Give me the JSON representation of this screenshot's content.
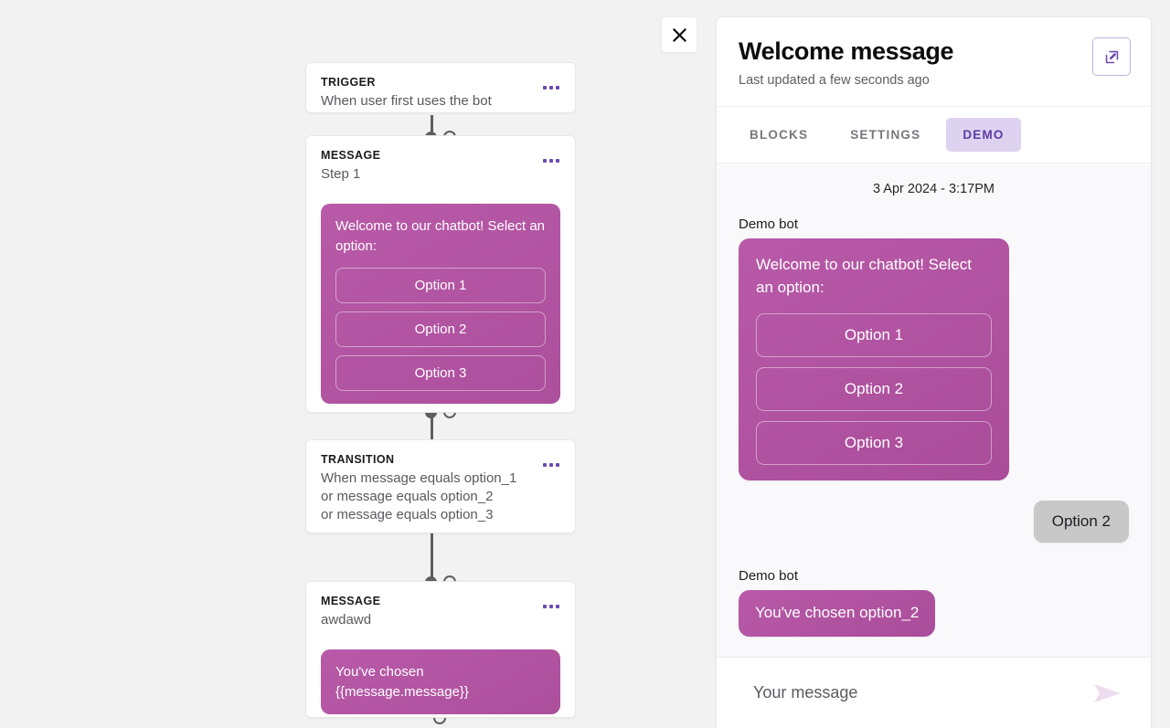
{
  "colors": {
    "canvas_bg": "#f2f2f2",
    "bubble_magenta": "#b2559f",
    "accent_purple": "#6c4ab0",
    "tab_active_bg": "#ddd2ef",
    "tab_active_text": "#5b3ba6",
    "user_bubble": "#c8c8c8",
    "chat_bg": "#f9f9fb",
    "connector": "#5e5e63",
    "send_icon": "#eddcee"
  },
  "flow": {
    "nodes": [
      {
        "kind": "TRIGGER",
        "title_lines": [
          "When user first uses the bot"
        ],
        "menu_icon": "ellipsis-icon",
        "bubble": null
      },
      {
        "kind": "MESSAGE",
        "title_lines": [
          "Step 1"
        ],
        "menu_icon": "ellipsis-icon",
        "bubble": {
          "text": "Welcome to our chatbot! Select an option:",
          "options": [
            "Option 1",
            "Option 2",
            "Option 3"
          ]
        }
      },
      {
        "kind": "TRANSITION",
        "title_lines": [
          "When message equals option_1",
          "or message equals option_2",
          "or message equals option_3"
        ],
        "menu_icon": "ellipsis-icon",
        "bubble": null
      },
      {
        "kind": "MESSAGE",
        "title_lines": [
          "awdawd"
        ],
        "menu_icon": "ellipsis-icon",
        "bubble": {
          "text": "You've chosen {{message.message}}",
          "options": []
        }
      }
    ]
  },
  "close_button": {
    "icon": "close-icon",
    "label": "Close"
  },
  "panel": {
    "title": "Welcome message",
    "subtitle": "Last updated a few seconds ago",
    "edit_button": {
      "icon": "edit-square-icon",
      "label": "Edit"
    },
    "tabs": [
      {
        "label": "BLOCKS",
        "active": false
      },
      {
        "label": "SETTINGS",
        "active": false
      },
      {
        "label": "DEMO",
        "active": true
      }
    ]
  },
  "demo": {
    "date": "3 Apr 2024 - 3:17PM",
    "messages": [
      {
        "type": "bot",
        "sender": "Demo bot",
        "text": "Welcome to our chatbot! Select an option:",
        "options": [
          "Option 1",
          "Option 2",
          "Option 3"
        ]
      },
      {
        "type": "user",
        "text": "Option 2"
      },
      {
        "type": "bot",
        "sender": "Demo bot",
        "text": "You've chosen option_2",
        "options": []
      }
    ],
    "composer": {
      "placeholder": "Your message",
      "value": "",
      "send_icon": "send-paper-plane-icon"
    }
  }
}
